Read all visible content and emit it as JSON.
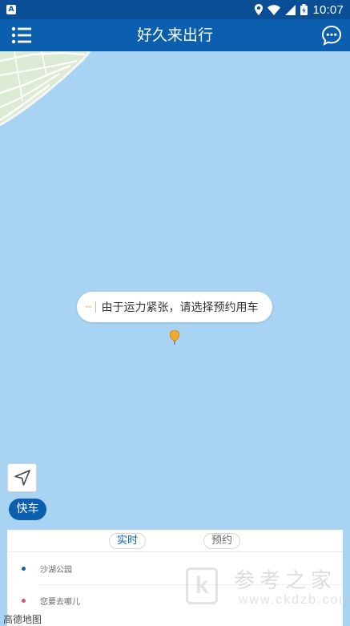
{
  "status_bar": {
    "time": "10:07",
    "app_icon_letter": "A"
  },
  "app_bar": {
    "title": "好久来出行",
    "menu_icon": "menu-list-icon",
    "chat_icon": "chat-bubble-icon"
  },
  "map": {
    "notice": {
      "text": "由于运力紧张，请选择预约用车",
      "dots": "···"
    },
    "pin_icon": "location-pin-icon",
    "locate_icon": "navigation-arrow-icon",
    "credit": "高德地图"
  },
  "car_type": {
    "label": "快车"
  },
  "order_panel": {
    "tabs": [
      {
        "label": "实时",
        "active": true
      },
      {
        "label": "预约",
        "active": false
      }
    ],
    "start": {
      "text": "沙湖公园"
    },
    "destination": {
      "placeholder": "您要去哪儿"
    }
  },
  "watermark": {
    "logo_letter": "k",
    "title": "参考之家",
    "url": "www.ckdzb.com"
  },
  "colors": {
    "primary": "#0b5fae",
    "status_bar": "#0a4f96",
    "water": "#a8d3f3",
    "accent": "#f29b2e",
    "destination_dot": "#d9556f"
  }
}
